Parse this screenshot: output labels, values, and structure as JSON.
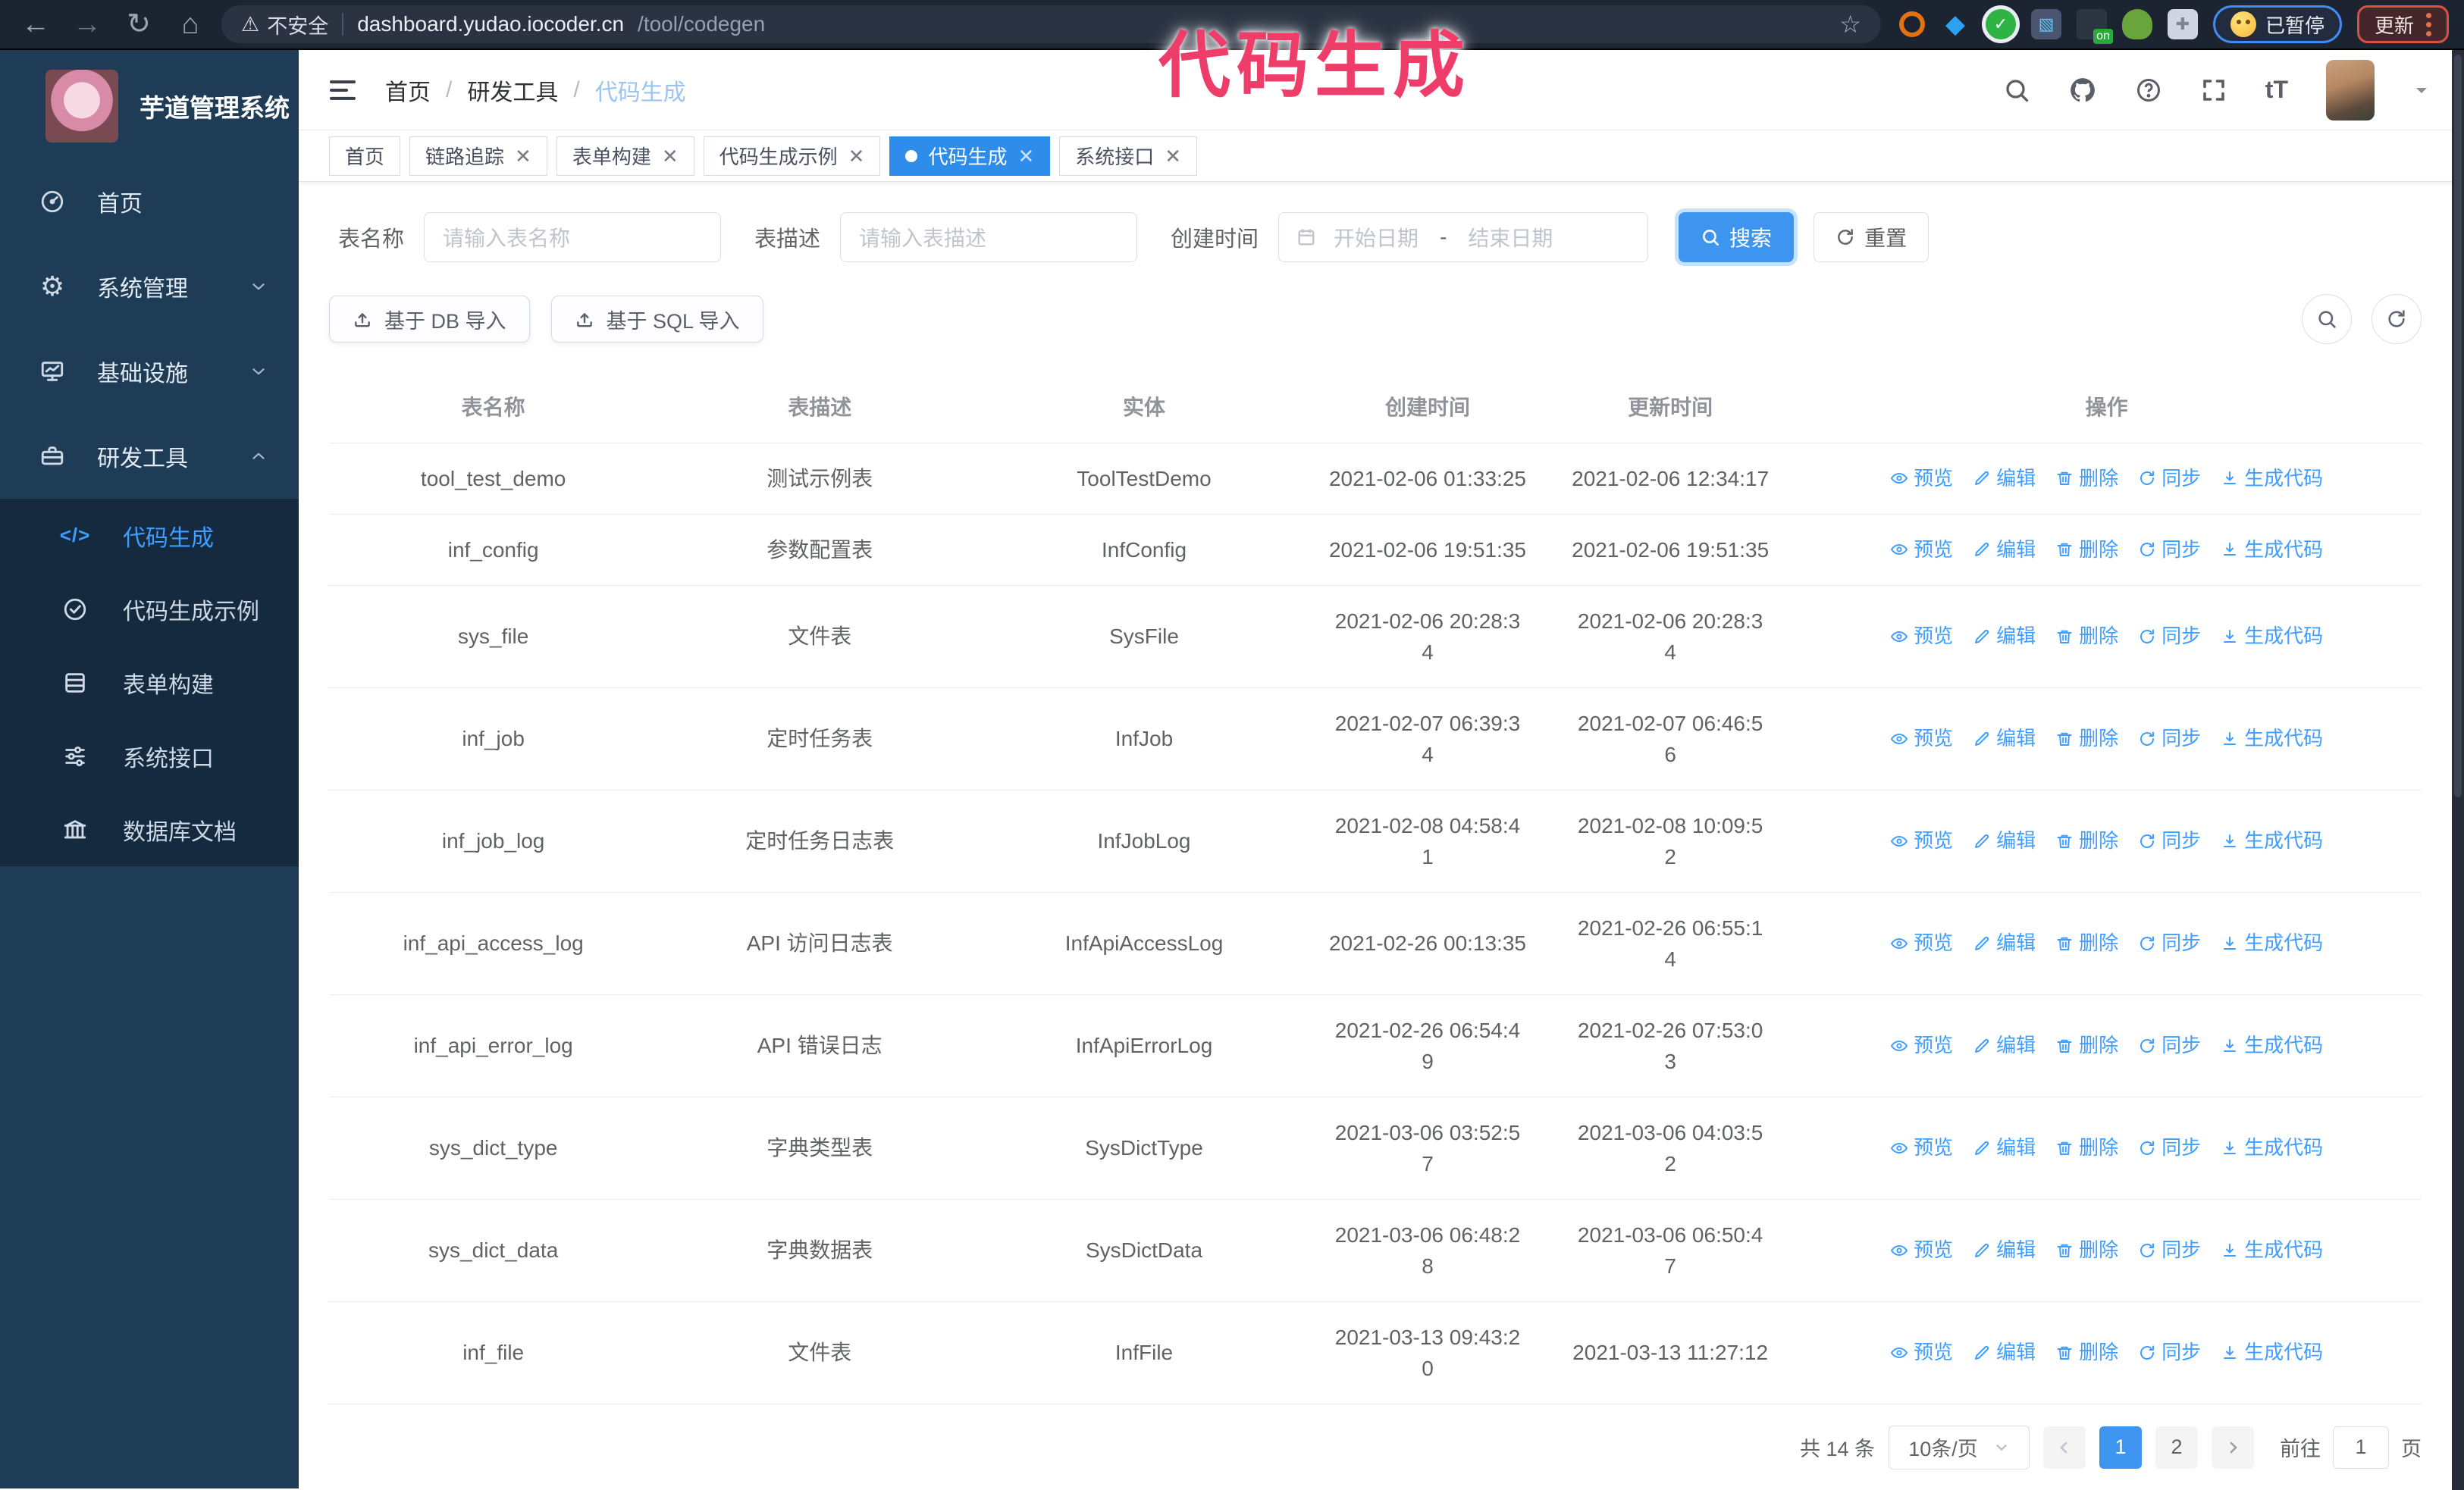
{
  "browser": {
    "back_icon": "back-arrow-icon",
    "forward_icon": "forward-arrow-icon",
    "reload_icon": "reload-icon",
    "home_icon": "home-icon",
    "security_label": "不安全",
    "url_host": "dashboard.yudao.iocoder.cn",
    "url_path": "/tool/codegen",
    "bookmark_icon": "star-icon",
    "paused_badge": "已暂停",
    "update_badge": "更新"
  },
  "annotation": {
    "text": "代码生成",
    "color": "#ee3d68"
  },
  "sidebar": {
    "title": "芋道管理系统",
    "logo_icon": "rabbit-logo",
    "items": [
      {
        "label": "首页",
        "icon": "dashboard-icon",
        "chevron": null
      },
      {
        "label": "系统管理",
        "icon": "gear-icon",
        "chevron": "down"
      },
      {
        "label": "基础设施",
        "icon": "infra-icon",
        "chevron": "down"
      },
      {
        "label": "研发工具",
        "icon": "tools-icon",
        "chevron": "up"
      }
    ],
    "submenu": [
      {
        "label": "代码生成",
        "icon": "code-icon",
        "active": true
      },
      {
        "label": "代码生成示例",
        "icon": "example-icon",
        "active": false
      },
      {
        "label": "表单构建",
        "icon": "form-icon",
        "active": false
      },
      {
        "label": "系统接口",
        "icon": "sliders-icon",
        "active": false
      },
      {
        "label": "数据库文档",
        "icon": "dbdoc-icon",
        "active": false
      }
    ]
  },
  "header": {
    "toggle_icon": "hamburger-icon",
    "breadcrumb": [
      "首页",
      "研发工具",
      "代码生成"
    ],
    "right_icons": [
      "search-icon",
      "github-icon",
      "help-icon",
      "fullscreen-icon",
      "fontsize-icon"
    ]
  },
  "tabbar": {
    "tabs": [
      {
        "label": "首页",
        "closable": false,
        "active": false
      },
      {
        "label": "链路追踪",
        "closable": true,
        "active": false
      },
      {
        "label": "表单构建",
        "closable": true,
        "active": false
      },
      {
        "label": "代码生成示例",
        "closable": true,
        "active": false
      },
      {
        "label": "代码生成",
        "closable": true,
        "active": true
      },
      {
        "label": "系统接口",
        "closable": true,
        "active": false
      }
    ]
  },
  "filters": {
    "table_name_label": "表名称",
    "table_name_placeholder": "请输入表名称",
    "table_desc_label": "表描述",
    "table_desc_placeholder": "请输入表描述",
    "create_time_label": "创建时间",
    "start_placeholder": "开始日期",
    "range_separator": "-",
    "end_placeholder": "结束日期",
    "search_label": "搜索",
    "reset_label": "重置"
  },
  "toolbar": {
    "import_db_label": "基于 DB 导入",
    "import_sql_label": "基于 SQL 导入",
    "circle_buttons": [
      "search-icon",
      "refresh-icon"
    ]
  },
  "table": {
    "columns": [
      "表名称",
      "表描述",
      "实体",
      "创建时间",
      "更新时间",
      "操作"
    ],
    "actions": [
      {
        "label": "预览",
        "icon": "eye-icon",
        "name": "preview"
      },
      {
        "label": "编辑",
        "icon": "pencil-icon",
        "name": "edit"
      },
      {
        "label": "删除",
        "icon": "trash-icon",
        "name": "delete"
      },
      {
        "label": "同步",
        "icon": "sync-icon",
        "name": "sync"
      },
      {
        "label": "生成代码",
        "icon": "download-icon",
        "name": "generate-code"
      }
    ],
    "rows": [
      {
        "name": "tool_test_demo",
        "desc": "测试示例表",
        "entity": "ToolTestDemo",
        "created": "2021-02-06 01:33:25",
        "updated": "2021-02-06 12:34:17"
      },
      {
        "name": "inf_config",
        "desc": "参数配置表",
        "entity": "InfConfig",
        "created": "2021-02-06 19:51:35",
        "updated": "2021-02-06 19:51:35"
      },
      {
        "name": "sys_file",
        "desc": "文件表",
        "entity": "SysFile",
        "created": "2021-02-06 20:28:3\n4",
        "updated": "2021-02-06 20:28:3\n4"
      },
      {
        "name": "inf_job",
        "desc": "定时任务表",
        "entity": "InfJob",
        "created": "2021-02-07 06:39:3\n4",
        "updated": "2021-02-07 06:46:5\n6"
      },
      {
        "name": "inf_job_log",
        "desc": "定时任务日志表",
        "entity": "InfJobLog",
        "created": "2021-02-08 04:58:4\n1",
        "updated": "2021-02-08 10:09:5\n2"
      },
      {
        "name": "inf_api_access_log",
        "desc": "API 访问日志表",
        "entity": "InfApiAccessLog",
        "created": "2021-02-26 00:13:35",
        "updated": "2021-02-26 06:55:1\n4"
      },
      {
        "name": "inf_api_error_log",
        "desc": "API 错误日志",
        "entity": "InfApiErrorLog",
        "created": "2021-02-26 06:54:4\n9",
        "updated": "2021-02-26 07:53:0\n3"
      },
      {
        "name": "sys_dict_type",
        "desc": "字典类型表",
        "entity": "SysDictType",
        "created": "2021-03-06 03:52:5\n7",
        "updated": "2021-03-06 04:03:5\n2"
      },
      {
        "name": "sys_dict_data",
        "desc": "字典数据表",
        "entity": "SysDictData",
        "created": "2021-03-06 06:48:2\n8",
        "updated": "2021-03-06 06:50:4\n7"
      },
      {
        "name": "inf_file",
        "desc": "文件表",
        "entity": "InfFile",
        "created": "2021-03-13 09:43:2\n0",
        "updated": "2021-03-13 11:27:12"
      }
    ]
  },
  "pagination": {
    "total_text": "共 14 条",
    "page_size": "10条/页",
    "pages": [
      "1",
      "2"
    ],
    "active_page": "1",
    "goto_label": "前往",
    "goto_value": "1",
    "page_suffix": "页"
  },
  "colors": {
    "accent_blue": "#409eff",
    "sidebar_bg": "#1e3c55",
    "submenu_bg": "#152a3f",
    "browser_bar_bg": "#1d2431",
    "annotation_pink": "#ee3d68"
  }
}
